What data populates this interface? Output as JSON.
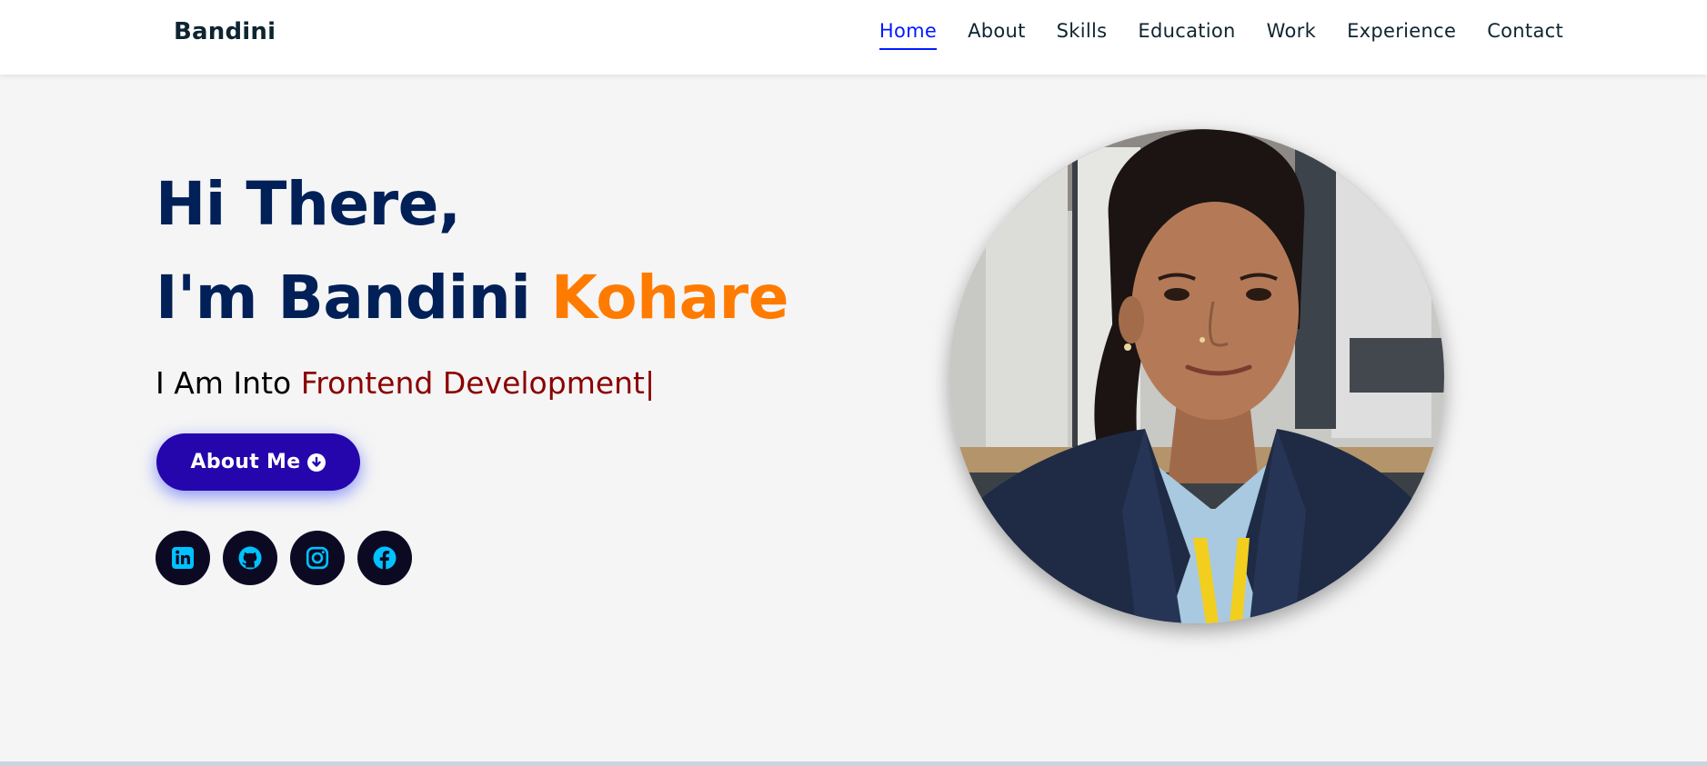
{
  "header": {
    "brand": "Bandini",
    "nav": [
      {
        "label": "Home",
        "active": true
      },
      {
        "label": "About"
      },
      {
        "label": "Skills"
      },
      {
        "label": "Education"
      },
      {
        "label": "Work"
      },
      {
        "label": "Experience"
      },
      {
        "label": "Contact"
      }
    ]
  },
  "hero": {
    "greeting": "Hi There,",
    "intro_prefix": "I'm Bandini",
    "intro_highlight": "Kohare",
    "typing_prefix": "I Am Into",
    "typing_role": "Frontend Development",
    "typing_cursor": "|",
    "button_label": "About Me",
    "button_icon": "arrow-circle-down-icon",
    "socials": [
      {
        "name": "linkedin-icon"
      },
      {
        "name": "github-icon"
      },
      {
        "name": "instagram-icon"
      },
      {
        "name": "facebook-icon"
      }
    ],
    "photo": "profile-photo"
  },
  "colors": {
    "navy": "#002057",
    "orange": "#ff7b00",
    "dark_red": "#8b0000",
    "button": "#2506ad",
    "nav_active": "#011aff",
    "social_bg": "#0c0a23",
    "social_icon": "#00c2ff"
  }
}
